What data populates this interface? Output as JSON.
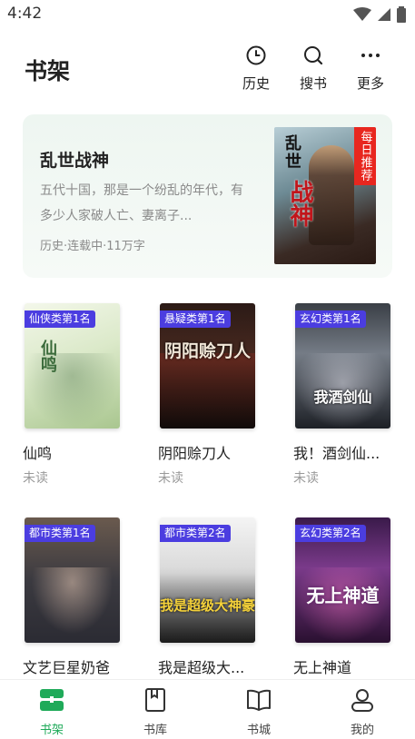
{
  "status_bar": {
    "time": "4:42"
  },
  "header": {
    "title": "书架",
    "actions": [
      {
        "label": "历史",
        "icon": "history-clock-icon"
      },
      {
        "label": "搜书",
        "icon": "search-icon"
      },
      {
        "label": "更多",
        "icon": "more-dots-icon"
      }
    ]
  },
  "featured": {
    "title": "乱世战神",
    "description": "五代十国，那是一个纷乱的年代，有多少人家破人亡、妻离子...",
    "meta": "历史·连载中·11万字",
    "cover_text_top": "乱世",
    "cover_text_main": "战神",
    "badge": "每日推荐"
  },
  "books": [
    {
      "title": "仙鸣",
      "status": "未读",
      "rank": "仙侠类第1名",
      "cover_text": "仙鸣"
    },
    {
      "title": "阴阳赊刀人",
      "status": "未读",
      "rank": "悬疑类第1名",
      "cover_text": "阴阳赊刀人"
    },
    {
      "title": "我！酒剑仙...",
      "status": "未读",
      "rank": "玄幻类第1名",
      "cover_text": "我酒剑仙"
    },
    {
      "title": "文艺巨星奶爸",
      "status": "",
      "rank": "都市类第1名",
      "cover_text": ""
    },
    {
      "title": "我是超级大...",
      "status": "",
      "rank": "都市类第2名",
      "cover_text": "我是超级大神豪"
    },
    {
      "title": "无上神道",
      "status": "",
      "rank": "玄幻类第2名",
      "cover_text": "无上神道"
    }
  ],
  "bottom_nav": [
    {
      "label": "书架",
      "icon": "bookshelf-icon",
      "active": true
    },
    {
      "label": "书库",
      "icon": "book-library-icon",
      "active": false
    },
    {
      "label": "书城",
      "icon": "open-book-icon",
      "active": false
    },
    {
      "label": "我的",
      "icon": "profile-icon",
      "active": false
    }
  ],
  "colors": {
    "accent": "#1faa59",
    "rank_badge": "#4b3de0",
    "daily_badge": "#e8271f"
  }
}
